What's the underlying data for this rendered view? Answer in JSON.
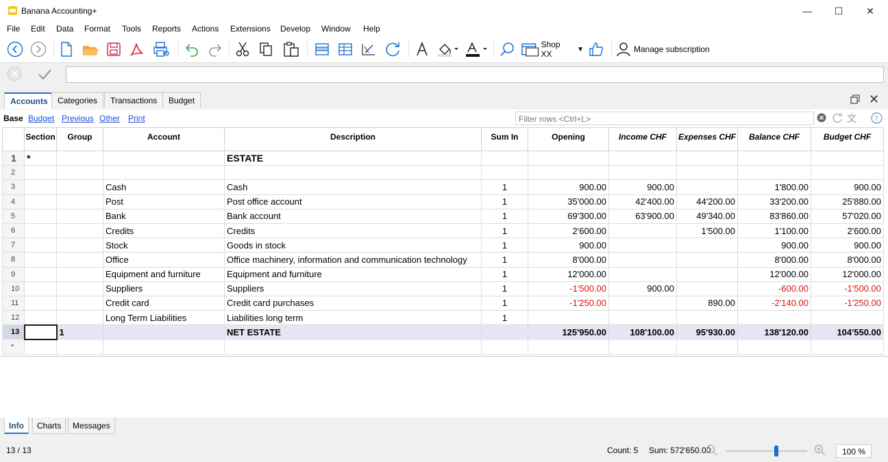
{
  "window": {
    "title": "Banana Accounting+"
  },
  "menu": [
    "File",
    "Edit",
    "Data",
    "Format",
    "Tools",
    "Reports",
    "Actions",
    "Extensions",
    "Develop",
    "Window",
    "Help"
  ],
  "toolbar": {
    "shop_label": "Shop XX",
    "subscription_label": "Manage subscription"
  },
  "tabs": [
    {
      "label": "Accounts",
      "active": true
    },
    {
      "label": "Categories"
    },
    {
      "label": "Transactions"
    },
    {
      "label": "Budget"
    }
  ],
  "views": [
    {
      "label": "Base",
      "active": true
    },
    {
      "label": "Budget"
    },
    {
      "label": "Previous"
    },
    {
      "label": "Other"
    },
    {
      "label": "Print"
    }
  ],
  "filter": {
    "placeholder": "Filter rows <Ctrl+L>"
  },
  "table": {
    "columns": [
      "Section",
      "Group",
      "Account",
      "Description",
      "Sum In",
      "Opening",
      "Income CHF",
      "Expenses CHF",
      "Balance CHF",
      "Budget CHF"
    ],
    "rows": [
      {
        "n": "1",
        "section": "*",
        "group": "",
        "account": "",
        "description": "ESTATE",
        "sumin": "",
        "opening": "",
        "income": "",
        "expenses": "",
        "balance": "",
        "budget": ""
      },
      {
        "n": "2",
        "section": "",
        "group": "",
        "account": "",
        "description": "",
        "sumin": "",
        "opening": "",
        "income": "",
        "expenses": "",
        "balance": "",
        "budget": ""
      },
      {
        "n": "3",
        "section": "",
        "group": "",
        "account": "Cash",
        "description": "Cash",
        "sumin": "1",
        "opening": "900.00",
        "income": "900.00",
        "expenses": "",
        "balance": "1'800.00",
        "budget": "900.00"
      },
      {
        "n": "4",
        "section": "",
        "group": "",
        "account": "Post",
        "description": "Post office account",
        "sumin": "1",
        "opening": "35'000.00",
        "income": "42'400.00",
        "expenses": "44'200.00",
        "balance": "33'200.00",
        "budget": "25'880.00"
      },
      {
        "n": "5",
        "section": "",
        "group": "",
        "account": "Bank",
        "description": "Bank account",
        "sumin": "1",
        "opening": "69'300.00",
        "income": "63'900.00",
        "expenses": "49'340.00",
        "balance": "83'860.00",
        "budget": "57'020.00"
      },
      {
        "n": "6",
        "section": "",
        "group": "",
        "account": "Credits",
        "description": "Credits",
        "sumin": "1",
        "opening": "2'600.00",
        "income": "",
        "expenses": "1'500.00",
        "balance": "1'100.00",
        "budget": "2'600.00"
      },
      {
        "n": "7",
        "section": "",
        "group": "",
        "account": "Stock",
        "description": "Goods in stock",
        "sumin": "1",
        "opening": "900.00",
        "income": "",
        "expenses": "",
        "balance": "900.00",
        "budget": "900.00"
      },
      {
        "n": "8",
        "section": "",
        "group": "",
        "account": "Office",
        "description": "Office machinery, information and communication technology",
        "sumin": "1",
        "opening": "8'000.00",
        "income": "",
        "expenses": "",
        "balance": "8'000.00",
        "budget": "8'000.00"
      },
      {
        "n": "9",
        "section": "",
        "group": "",
        "account": "Equipment and furniture",
        "description": "Equipment and furniture",
        "sumin": "1",
        "opening": "12'000.00",
        "income": "",
        "expenses": "",
        "balance": "12'000.00",
        "budget": "12'000.00"
      },
      {
        "n": "10",
        "section": "",
        "group": "",
        "account": "Suppliers",
        "description": "Suppliers",
        "sumin": "1",
        "opening": "-1'500.00",
        "income": "900.00",
        "expenses": "",
        "balance": "-600.00",
        "budget": "-1'500.00"
      },
      {
        "n": "11",
        "section": "",
        "group": "",
        "account": "Credit card",
        "description": "Credit card purchases",
        "sumin": "1",
        "opening": "-1'250.00",
        "income": "",
        "expenses": "890.00",
        "balance": "-2'140.00",
        "budget": "-1'250.00"
      },
      {
        "n": "12",
        "section": "",
        "group": "",
        "account": "Long Term Liabilities",
        "description": "Liabilities long term",
        "sumin": "1",
        "opening": "",
        "income": "",
        "expenses": "",
        "balance": "",
        "budget": ""
      },
      {
        "n": "13",
        "section": "",
        "group": "1",
        "account": "",
        "description": "NET ESTATE",
        "sumin": "",
        "opening": "125'950.00",
        "income": "108'100.00",
        "expenses": "95'930.00",
        "balance": "138'120.00",
        "budget": "104'550.00"
      },
      {
        "n": "*",
        "section": "",
        "group": "",
        "account": "",
        "description": "",
        "sumin": "",
        "opening": "",
        "income": "",
        "expenses": "",
        "balance": "",
        "budget": ""
      }
    ]
  },
  "bottom_tabs": [
    {
      "label": "Info",
      "active": true
    },
    {
      "label": "Charts"
    },
    {
      "label": "Messages"
    }
  ],
  "status": {
    "position": "13 / 13",
    "count": "Count: 5",
    "sum": "Sum: 572'650.00",
    "zoom": "100 %",
    "zoom_level": 0.6
  },
  "colors": {
    "accent": "#1f6fd1",
    "negative": "#e01010",
    "total_row": "#e4e7f3"
  }
}
